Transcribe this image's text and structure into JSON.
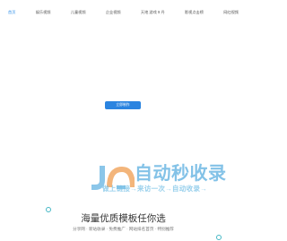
{
  "nav": {
    "items": [
      {
        "label": "首页",
        "active": true
      },
      {
        "label": "娱乐视频",
        "active": false
      },
      {
        "label": "儿童视频",
        "active": false
      },
      {
        "label": "企业视频",
        "active": false
      },
      {
        "label": "天地 游戏 9 丹",
        "active": false
      },
      {
        "label": "影视点击榜",
        "active": false
      },
      {
        "label": "网红视频",
        "active": false
      }
    ]
  },
  "cta": {
    "label": "立即制作"
  },
  "brand": {
    "title": "自动秒收录",
    "subtitle": "做上链接→来访一次→自动收录→"
  },
  "tagline": "海量优质模板任你选",
  "description": "分享网 · 新站收录 · 免费推广 · 网站排名首页 · 特别推荐"
}
